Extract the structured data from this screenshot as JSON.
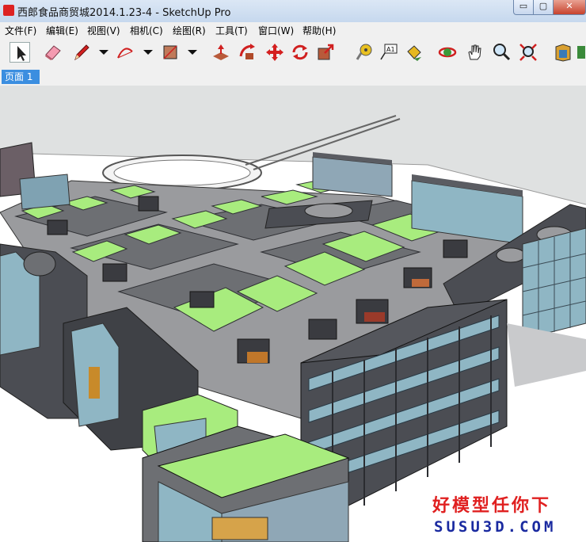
{
  "window": {
    "title": "西郎食品商贸城2014.1.23-4 - SketchUp Pro",
    "controls": {
      "minimize": "▭",
      "maximize": "▢",
      "close": "✕"
    }
  },
  "menu": [
    {
      "label": "文件(F)"
    },
    {
      "label": "编辑(E)"
    },
    {
      "label": "视图(V)"
    },
    {
      "label": "相机(C)"
    },
    {
      "label": "绘图(R)"
    },
    {
      "label": "工具(T)"
    },
    {
      "label": "窗口(W)"
    },
    {
      "label": "帮助(H)"
    }
  ],
  "toolbar": {
    "tools": [
      {
        "name": "select-tool-icon",
        "selected": true
      },
      {
        "name": "eraser-tool-icon"
      },
      {
        "name": "pencil-line-tool-icon"
      },
      {
        "name": "line-dropdown-icon"
      },
      {
        "name": "arc-tool-icon"
      },
      {
        "name": "arc-dropdown-icon"
      },
      {
        "name": "rectangle-tool-icon"
      },
      {
        "name": "shape-dropdown-icon"
      },
      {
        "name": "push-pull-tool-icon"
      },
      {
        "name": "follow-me-tool-icon"
      },
      {
        "name": "move-tool-icon"
      },
      {
        "name": "rotate-tool-icon"
      },
      {
        "name": "scale-tool-icon"
      },
      {
        "name": "tape-measure-tool-icon"
      },
      {
        "name": "text-tool-icon"
      },
      {
        "name": "paint-bucket-tool-icon"
      },
      {
        "name": "orbit-tool-icon"
      },
      {
        "name": "pan-tool-icon"
      },
      {
        "name": "zoom-tool-icon"
      },
      {
        "name": "zoom-extents-tool-icon"
      },
      {
        "name": "warehouse-icon"
      },
      {
        "name": "extension-warehouse-icon"
      }
    ]
  },
  "tabs": [
    {
      "label": "页面 1",
      "active": true
    }
  ],
  "watermark": {
    "line1": "好模型任你下",
    "line2": "SUSU3D.COM"
  },
  "colors": {
    "sky": "#dfe1e1",
    "roof_green": "#a8ec7e",
    "building_dark": "#4b4d53",
    "glass": "#8fb6c4",
    "ground": "#ffffff",
    "tab_active": "#3b8ee0",
    "watermark_red": "#e02020",
    "watermark_blue": "#1a2aa0"
  }
}
